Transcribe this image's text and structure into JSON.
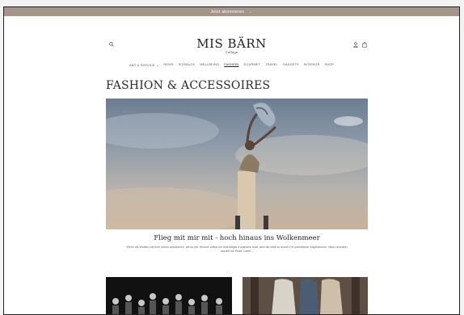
{
  "announcement": {
    "text": "Jetzt abonnieren",
    "arrow": "→"
  },
  "header": {
    "logo": "MIS BÄRN",
    "logo_sub": "Collage"
  },
  "nav": {
    "items": [
      {
        "label": "ABO & SERVICE ⌄",
        "active": false
      },
      {
        "label": "NEWS",
        "active": false
      },
      {
        "label": "SCHMUCK",
        "active": false
      },
      {
        "label": "WELLBEING",
        "active": false
      },
      {
        "label": "FASHION",
        "active": true
      },
      {
        "label": "GOURMET",
        "active": false
      },
      {
        "label": "TRAVEL",
        "active": false
      },
      {
        "label": "GADGETS",
        "active": false
      },
      {
        "label": "INTERIOR",
        "active": false
      },
      {
        "label": "SHOP",
        "active": false
      }
    ]
  },
  "page": {
    "title": "FASHION & ACCESSOIRES"
  },
  "article": {
    "title": "Flieg mit mir mit - hoch hinaus ins Wolkenmeer",
    "excerpt": "Wenn die Wolken mit Ihen einem ausdehnen, als ob der Himmel selbst ein lebendiges Kunstwerk malt, wird die Welt zu einem Ort unendlicher Inspirationen. Nina Lehmann tanzert mit Peam Label..."
  },
  "colors": {
    "announcement_bg": "#a69489",
    "text": "#222222"
  },
  "icons": [
    "search-icon",
    "account-icon",
    "bag-icon"
  ]
}
